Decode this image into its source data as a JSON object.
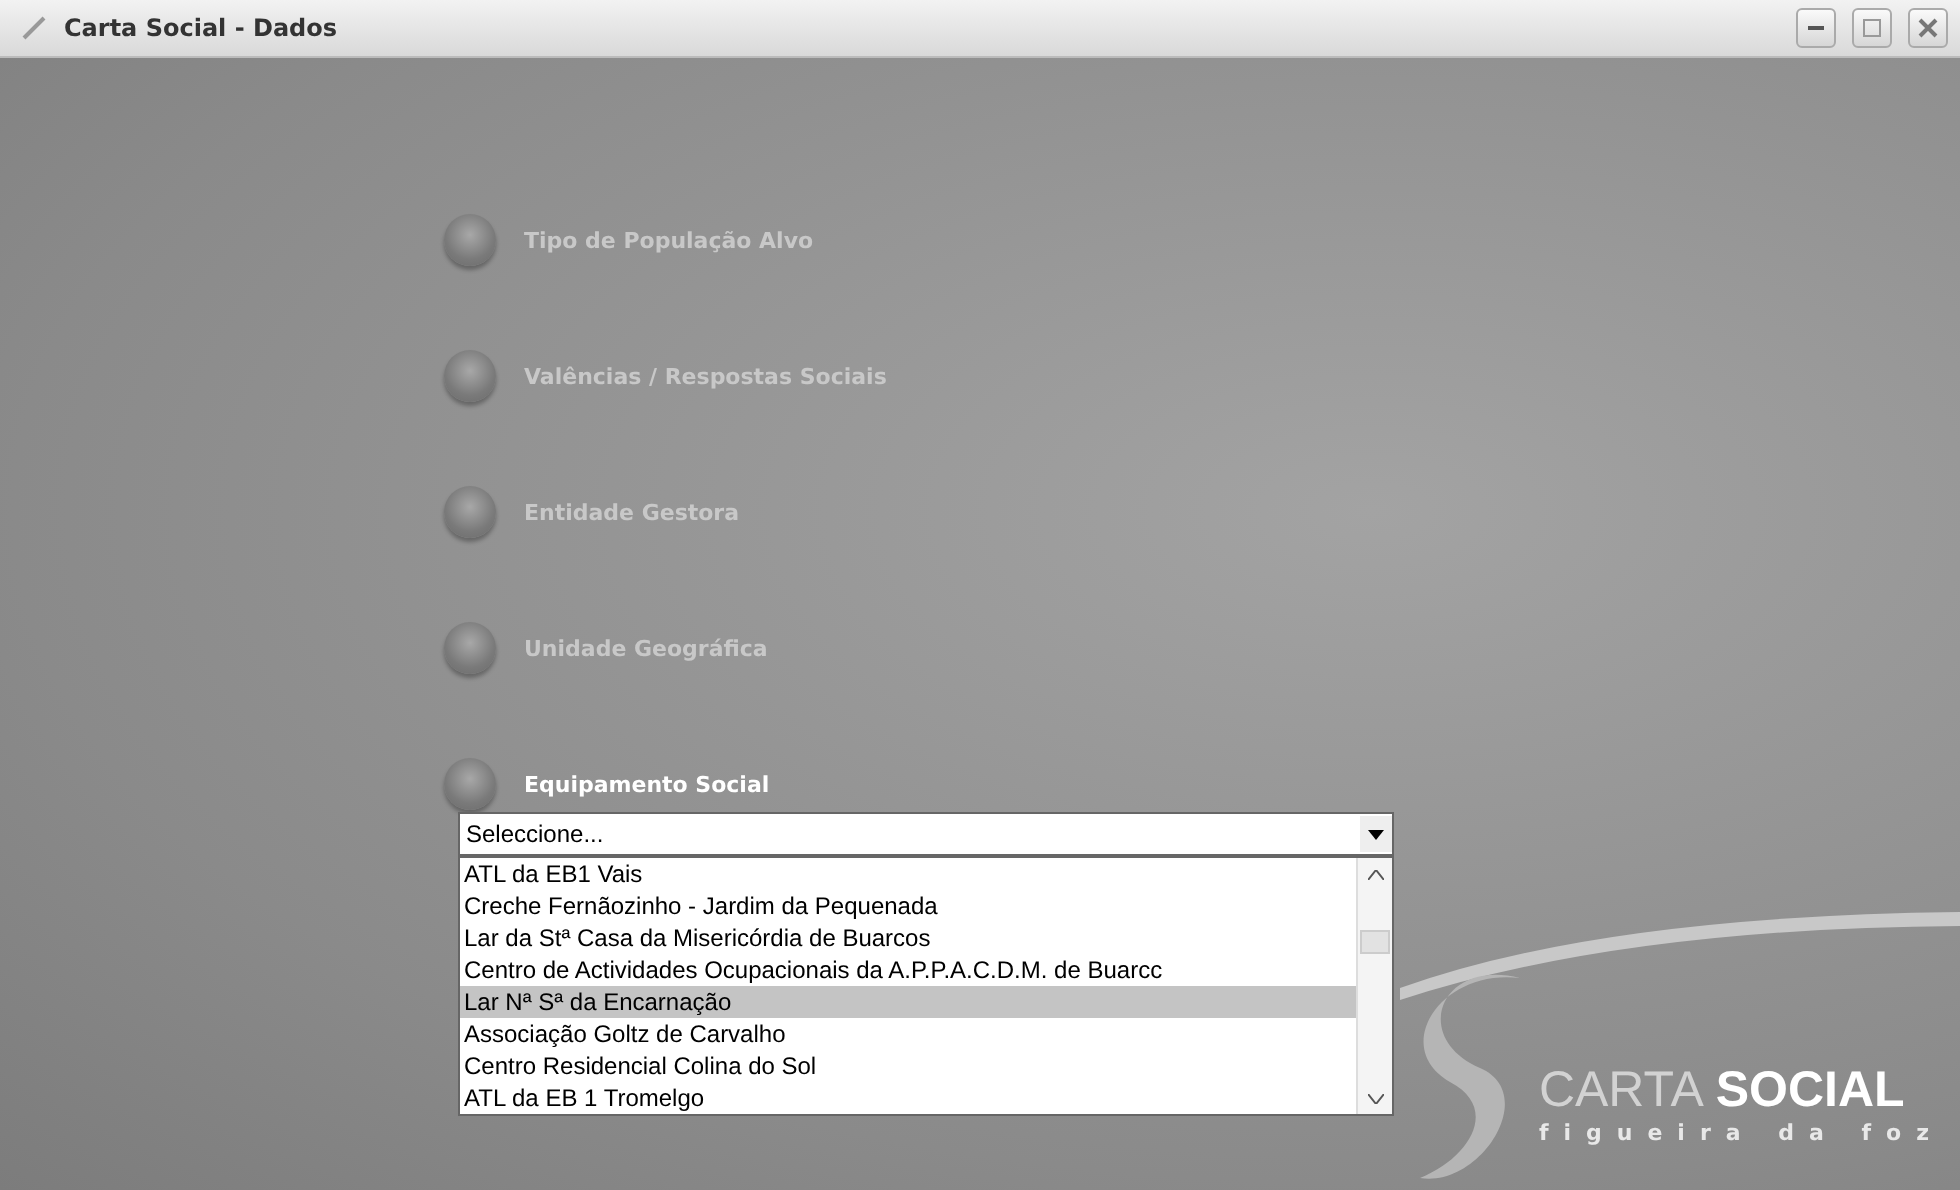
{
  "window": {
    "title": "Carta Social - Dados"
  },
  "menu": [
    {
      "label": "Tipo de População Alvo",
      "selected": false
    },
    {
      "label": "Valências / Respostas Sociais",
      "selected": false
    },
    {
      "label": "Entidade Gestora",
      "selected": false
    },
    {
      "label": "Unidade Geográfica",
      "selected": false
    },
    {
      "label": "Equipamento Social",
      "selected": true
    }
  ],
  "dropdown": {
    "value": "Seleccione...",
    "options": [
      {
        "label": "ATL da EB1 Vais",
        "selected": false
      },
      {
        "label": "Creche Fernãozinho - Jardim da Pequenada",
        "selected": false
      },
      {
        "label": "Lar da Stª Casa da Misericórdia de Buarcos",
        "selected": false
      },
      {
        "label": "Centro de Actividades Ocupacionais da A.P.P.A.C.D.M. de Buarcc",
        "selected": false
      },
      {
        "label": "Lar Nª Sª da Encarnação",
        "selected": true
      },
      {
        "label": "Associação Goltz de Carvalho",
        "selected": false
      },
      {
        "label": "Centro Residencial Colina do Sol",
        "selected": false
      },
      {
        "label": "ATL da EB 1 Tromelgo",
        "selected": false
      }
    ]
  },
  "logo": {
    "word_1": "CARTA",
    "word_2": "SOCIAL",
    "tagline": "figueira da foz"
  }
}
